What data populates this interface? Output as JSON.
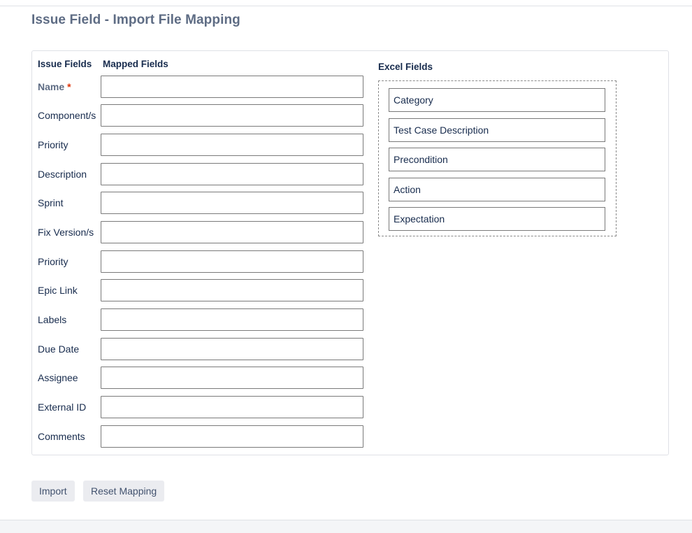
{
  "page": {
    "title": "Issue Field - Import File Mapping"
  },
  "mapping": {
    "issue_fields_header": "Issue Fields",
    "mapped_fields_header": "Mapped Fields",
    "required_marker": "*",
    "rows": [
      {
        "label": "Name",
        "required": true,
        "value": ""
      },
      {
        "label": "Component/s",
        "required": false,
        "value": ""
      },
      {
        "label": "Priority",
        "required": false,
        "value": ""
      },
      {
        "label": "Description",
        "required": false,
        "value": ""
      },
      {
        "label": "Sprint",
        "required": false,
        "value": ""
      },
      {
        "label": "Fix Version/s",
        "required": false,
        "value": ""
      },
      {
        "label": "Priority",
        "required": false,
        "value": ""
      },
      {
        "label": "Epic Link",
        "required": false,
        "value": ""
      },
      {
        "label": "Labels",
        "required": false,
        "value": ""
      },
      {
        "label": "Due Date",
        "required": false,
        "value": ""
      },
      {
        "label": "Assignee",
        "required": false,
        "value": ""
      },
      {
        "label": "External ID",
        "required": false,
        "value": ""
      },
      {
        "label": "Comments",
        "required": false,
        "value": ""
      }
    ]
  },
  "excel": {
    "header": "Excel Fields",
    "items": [
      "Category",
      "Test Case Description",
      "Precondition",
      "Action",
      "Expectation"
    ]
  },
  "actions": {
    "import_label": "Import",
    "reset_label": "Reset Mapping"
  },
  "colors": {
    "title": "#5e6c84",
    "required_star": "#de350b",
    "button_bg": "#ebecf0"
  }
}
